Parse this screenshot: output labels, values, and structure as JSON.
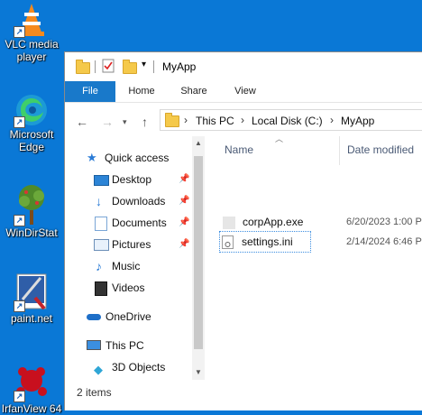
{
  "desktop": {
    "icons": [
      {
        "name": "vlc",
        "label_line1": "VLC media",
        "label_line2": "player"
      },
      {
        "name": "edge",
        "label_line1": "Microsoft",
        "label_line2": "Edge"
      },
      {
        "name": "windirstat",
        "label_line1": "WinDirStat",
        "label_line2": ""
      },
      {
        "name": "paint",
        "label_line1": "paint.net",
        "label_line2": ""
      },
      {
        "name": "ifranview",
        "label_line1": "IrfanView 64",
        "label_line2": ""
      }
    ]
  },
  "window": {
    "title": "MyApp",
    "ribbon_tabs": [
      "File",
      "Home",
      "Share",
      "View"
    ],
    "address": {
      "crumbs": [
        "This PC",
        "Local Disk (C:)",
        "MyApp"
      ]
    },
    "nav": {
      "quick_access": "Quick access",
      "items": [
        "Desktop",
        "Downloads",
        "Documents",
        "Pictures",
        "Music",
        "Videos"
      ],
      "onedrive": "OneDrive",
      "this_pc": "This PC",
      "objects": "3D Objects"
    },
    "list": {
      "col_name": "Name",
      "col_date": "Date modified",
      "files": [
        {
          "name": "corpApp.exe",
          "date": "6/20/2023 1:00 P"
        },
        {
          "name": "settings.ini",
          "date": "2/14/2024 6:46 P"
        }
      ]
    },
    "status": "2 items"
  },
  "colors": {
    "desktop": "#0a78d6",
    "file_tab": "#1979ca",
    "folder": "#f5c94a"
  }
}
